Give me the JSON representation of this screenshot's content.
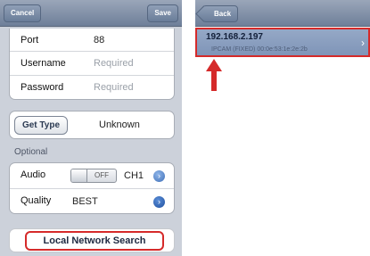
{
  "left": {
    "nav": {
      "cancel_label": "Cancel",
      "save_label": "Save"
    },
    "fields": {
      "port_label": "Port",
      "port_value": "88",
      "username_label": "Username",
      "username_placeholder": "Required",
      "password_label": "Password",
      "password_placeholder": "Required"
    },
    "type": {
      "button_label": "Get Type",
      "value": "Unknown"
    },
    "optional": {
      "section_label": "Optional",
      "audio_label": "Audio",
      "audio_toggle": "OFF",
      "audio_channel": "CH1",
      "quality_label": "Quality",
      "quality_value": "BEST"
    },
    "search_button_label": "Local Network Search"
  },
  "right": {
    "nav": {
      "back_label": "Back"
    },
    "device": {
      "ip": "192.168.2.197",
      "details": "IPCAM (FIXED)   00:0e:53:1e:2e:2b"
    }
  },
  "colors": {
    "highlight": "#d52a2a",
    "navbar": "#7f8fa8",
    "selected_row": "#8aa0c2"
  },
  "icons": {
    "disclosure": "chevron-right-icon",
    "arrow": "arrow-up-icon"
  }
}
